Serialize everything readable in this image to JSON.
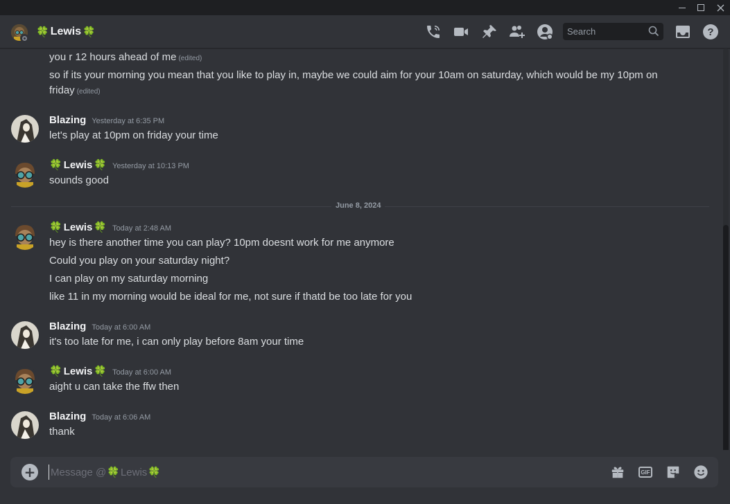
{
  "window": {
    "minimize_icon": "minimize-icon",
    "maximize_icon": "maximize-icon",
    "close_icon": "close-icon"
  },
  "header": {
    "channel_name": "Lewis",
    "clover": "🍀",
    "search_placeholder": "Search",
    "icons": [
      "voice-call-icon",
      "video-call-icon",
      "pinned-icon",
      "add-friends-icon",
      "user-profile-icon",
      "inbox-icon",
      "help-icon"
    ]
  },
  "messages": {
    "continued": [
      {
        "text": "you r 12 hours ahead of me",
        "edited": "(edited)"
      },
      {
        "text": "so if its your morning you mean that you like to play in, maybe we could aim for your 10am on saturday, which would be my 10pm on",
        "edited": ""
      },
      {
        "text": "friday",
        "edited": "(edited)"
      }
    ],
    "groups": [
      {
        "author": "Blazing",
        "clovers": false,
        "timestamp": "Yesterday at 6:35 PM",
        "lines": [
          "let's play at 10pm on friday your time"
        ]
      },
      {
        "author": "Lewis",
        "clovers": true,
        "timestamp": "Yesterday at 10:13 PM",
        "lines": [
          "sounds good"
        ]
      },
      {
        "author": "Lewis",
        "clovers": true,
        "timestamp": "Today at 2:48 AM",
        "lines": [
          "hey is there another time you can play? 10pm doesnt work for me anymore",
          "Could you play on your saturday night?",
          "I can play on my saturday morning",
          "like 11 in my morning would be ideal for me, not sure if thatd be too late for you"
        ]
      },
      {
        "author": "Blazing",
        "clovers": false,
        "timestamp": "Today at 6:00 AM",
        "lines": [
          "it's too late for me, i can only play before 8am your time"
        ]
      },
      {
        "author": "Lewis",
        "clovers": true,
        "timestamp": "Today at 6:00 AM",
        "lines": [
          "aight u can take the ffw then"
        ]
      },
      {
        "author": "Blazing",
        "clovers": false,
        "timestamp": "Today at 6:06 AM",
        "lines": [
          "thank"
        ]
      }
    ],
    "date_divider": "June 8, 2024"
  },
  "composer": {
    "placeholder_prefix": "Message @",
    "placeholder_name": "Lewis",
    "icons": [
      "add-attachment-icon",
      "gift-icon",
      "gif-icon",
      "sticker-icon",
      "emoji-icon"
    ],
    "gif_label": "GIF"
  }
}
